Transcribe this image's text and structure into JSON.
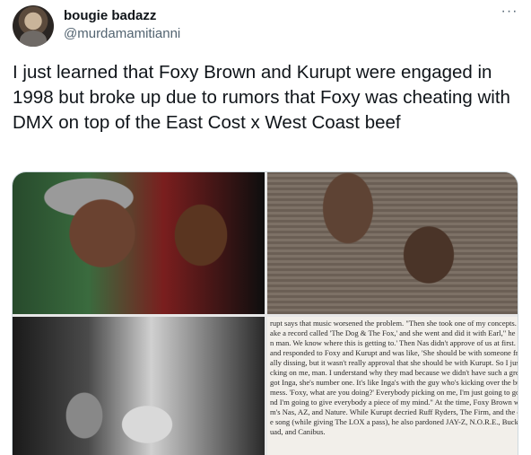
{
  "tweet": {
    "author_name": "bougie badazz",
    "author_handle": "@murdamamitianni",
    "more_label": "···",
    "text": "I just learned that Foxy Brown and Kurupt were engaged in 1998 but broke up due to rumors that Foxy was cheating with DMX on top of the East Cost x West Coast beef"
  },
  "media": {
    "article_lines": [
      "rupt says that music worsened the problem. \"Then she took one of my concepts. We",
      "ake a record called 'The Dog & The Fox,' and she went and did it with Earl,\" he continu",
      "n man. We know where this is getting to.' Then Nas didn't approve of us at first. He g",
      "and responded to Foxy and Kurupt and was like, 'She should be with someone from",
      "ally dissing, but it wasn't really approval that she should be with Kurupt. So I just felt",
      "cking on me, man. I understand why they mad because we didn't have such a great",
      "got Inga, she's number one. It's like Inga's with the guy who's kicking over the buildin",
      "mess. 'Foxy, what are you doing?' Everybody picking on me, I'm just going to go ba",
      "nd I'm going to give everybody a piece of my mind.\" At the time, Foxy Brown was sti",
      "m's Nas, AZ, and Nature. While Kurupt decried Ruff Ryders, The Firm, and the cast o",
      "e song (while giving The LOX a pass), he also pardoned JAY-Z, N.O.R.E., Buckshot, W",
      "uad, and Canibus."
    ]
  }
}
